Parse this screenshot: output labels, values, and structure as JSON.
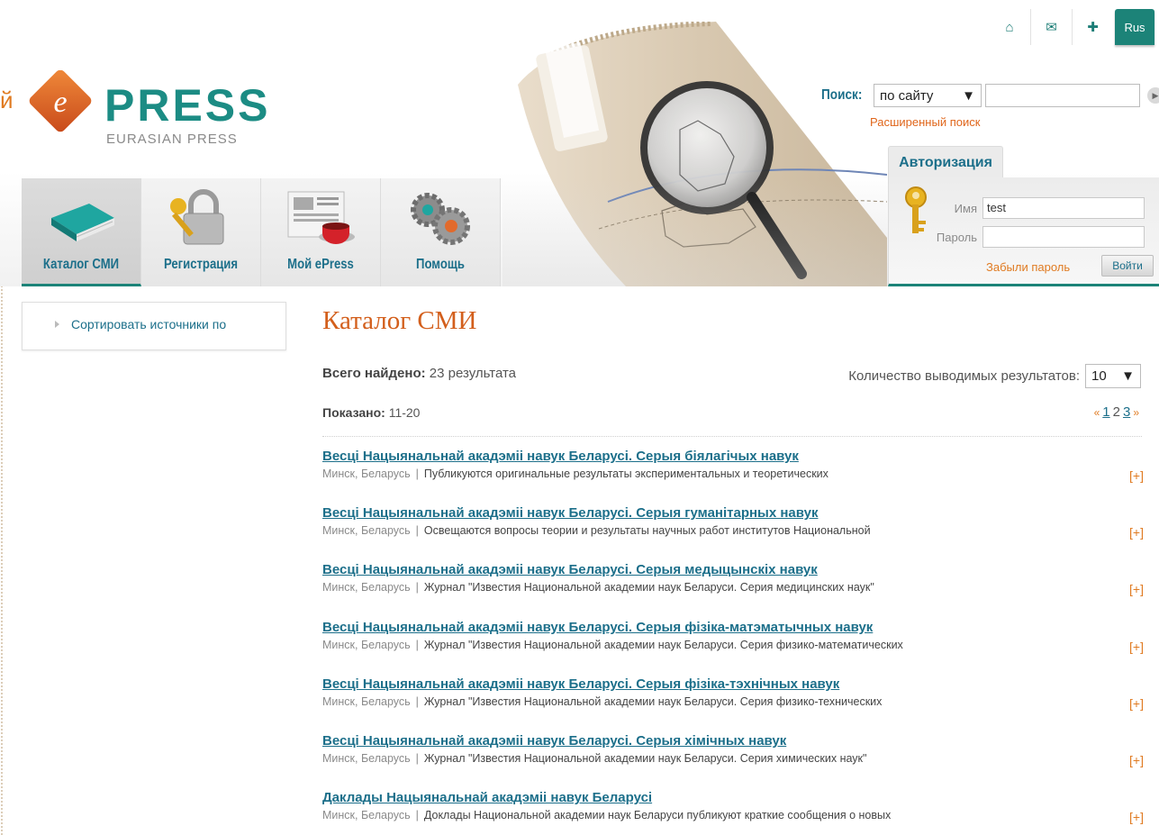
{
  "header": {
    "logo_stray_char": "й",
    "logo_word": "PRESS",
    "logo_sub": "EURASIAN PRESS",
    "top_icons": [
      "home-icon",
      "mail-icon",
      "plus-icon"
    ],
    "lang_button": "Rus"
  },
  "search": {
    "label": "Поиск:",
    "scope_value": "по сайту",
    "query_value": "",
    "advanced_link": "Расширенный поиск"
  },
  "auth": {
    "tab_label": "Авторизация",
    "name_label": "Имя",
    "name_value": "test",
    "password_label": "Пароль",
    "password_value": "",
    "forgot_link": "Забыли пароль",
    "login_button": "Войти"
  },
  "nav": {
    "items": [
      {
        "label": "Каталог СМИ",
        "icon": "book-icon",
        "active": true
      },
      {
        "label": "Регистрация",
        "icon": "padlock-key-icon",
        "active": false
      },
      {
        "label": "Мой ePress",
        "icon": "newspaper-cup-icon",
        "active": false
      },
      {
        "label": "Помощь",
        "icon": "gears-icon",
        "active": false
      }
    ]
  },
  "sidebar": {
    "sort_label": "Сортировать источники по"
  },
  "main": {
    "title": "Каталог СМИ",
    "total_label": "Всего найдено:",
    "total_value": "23 результата",
    "per_page_label": "Количество выводимых результатов:",
    "per_page_value": "10",
    "shown_label": "Показано:",
    "shown_value": "11-20",
    "pager": {
      "prev": "«",
      "pages": [
        "1",
        "2",
        "3"
      ],
      "current": "2",
      "next": "»"
    },
    "results": [
      {
        "title": "Весці Нацыянальнай акадэміі навук Беларусі. Серыя біялагічых навук",
        "location": "Минск, Беларусь",
        "desc": "Публикуются оригинальные результаты экспериментальных и теоретических",
        "more": "[+]"
      },
      {
        "title": "Весці Нацыянальнай акадэміі навук Беларусі. Серыя гуманітарных навук",
        "location": "Минск, Беларусь",
        "desc": "Освещаются вопросы теории и результаты научных работ институтов Национальной",
        "more": "[+]"
      },
      {
        "title": "Весці Нацыянальнай акадэміі навук Беларусі. Серыя медыцынскіх навук",
        "location": "Минск, Беларусь",
        "desc": "Журнал \"Известия Национальной академии наук Беларуси. Серия медицинских наук\"",
        "more": "[+]"
      },
      {
        "title": "Весці Нацыянальнай акадэміі навук Беларусі. Серыя фізіка-матэматычных навук",
        "location": "Минск, Беларусь",
        "desc": "Журнал \"Известия Национальной академии наук Беларуси. Серия физико-математических",
        "more": "[+]"
      },
      {
        "title": "Весці Нацыянальнай акадэміі навук Беларусі. Серыя фізіка-тэхнічных навук",
        "location": "Минск, Беларусь",
        "desc": "Журнал \"Известия Национальной академии наук Беларуси. Серия физико-технических",
        "more": "[+]"
      },
      {
        "title": "Весці Нацыянальнай акадэміі навук Беларусі. Серыя хімічных навук",
        "location": "Минск, Беларусь",
        "desc": "Журнал \"Известия Национальной академии наук Беларуси. Серия химических наук\"",
        "more": "[+]"
      },
      {
        "title": "Даклады Нацыянальнай акадэміі навук Беларусі",
        "location": "Минск, Беларусь",
        "desc": "Доклады Национальной академии наук Беларуси публикуют краткие сообщения о новых",
        "more": "[+]"
      }
    ]
  },
  "colors": {
    "brand_teal": "#1c8378",
    "link_blue": "#1c6f8a",
    "accent_orange": "#e07b22",
    "title_orange": "#d35f1c"
  }
}
